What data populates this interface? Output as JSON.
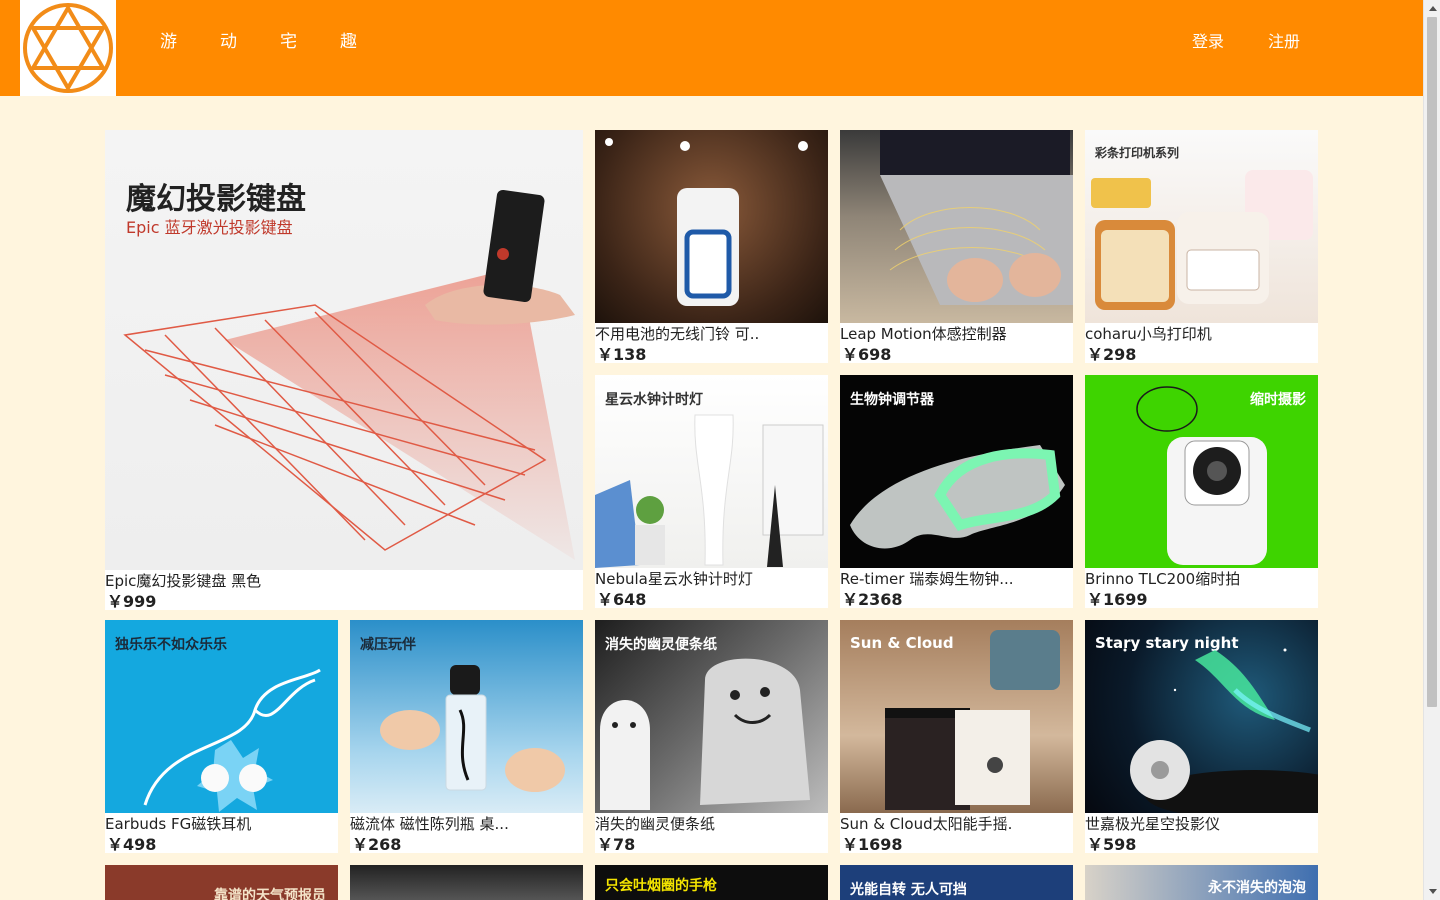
{
  "colors": {
    "header_bg": "#ff8a00",
    "page_bg": "#fff5de",
    "logo_stroke": "#f28c18"
  },
  "brand": {
    "logo_icon": "star-of-david-icon"
  },
  "nav": {
    "items": [
      "游",
      "动",
      "宅",
      "趣"
    ]
  },
  "auth": {
    "login": "登录",
    "register": "注册"
  },
  "featured": {
    "title": "魔幻投影键盘",
    "subtitle": "Epic 蓝牙激光投影键盘",
    "name": "Epic魔幻投影键盘 黑色",
    "price": "￥999"
  },
  "products": [
    {
      "name": "不用电池的无线门铃 可..",
      "price": "￥138",
      "caption": ""
    },
    {
      "name": "Leap Motion体感控制器",
      "price": "￥698",
      "caption": ""
    },
    {
      "name": "coharu小鸟打印机",
      "price": "￥298",
      "caption": "彩条打印机系列"
    },
    {
      "name": "Nebula星云水钟计时灯",
      "price": "￥648",
      "caption": "星云水钟计时灯"
    },
    {
      "name": "Re-timer 瑞泰姆生物钟...",
      "price": "￥2368",
      "caption": "生物钟调节器"
    },
    {
      "name": "Brinno TLC200缩时拍",
      "price": "￥1699",
      "caption": "缩时摄影"
    },
    {
      "name": "Earbuds FG磁铁耳机",
      "price": "￥498",
      "caption": "独乐乐不如众乐乐"
    },
    {
      "name": "磁流体 磁性陈列瓶 桌...",
      "price": "￥268",
      "caption": "减压玩伴"
    },
    {
      "name": "消失的幽灵便条纸",
      "price": "￥78",
      "caption": "消失的幽灵便条纸"
    },
    {
      "name": "Sun & Cloud太阳能手摇.",
      "price": "￥1698",
      "caption": "Sun & Cloud"
    },
    {
      "name": "世嘉极光星空投影仪",
      "price": "￥598",
      "caption": "Stary stary night"
    }
  ],
  "partial_row": [
    {
      "caption": "靠谱的天气预报员"
    },
    {
      "caption": ""
    },
    {
      "caption": "只会吐烟圈的手枪"
    },
    {
      "caption": "光能自转 无人可挡"
    },
    {
      "caption": "永不消失的泡泡"
    }
  ]
}
